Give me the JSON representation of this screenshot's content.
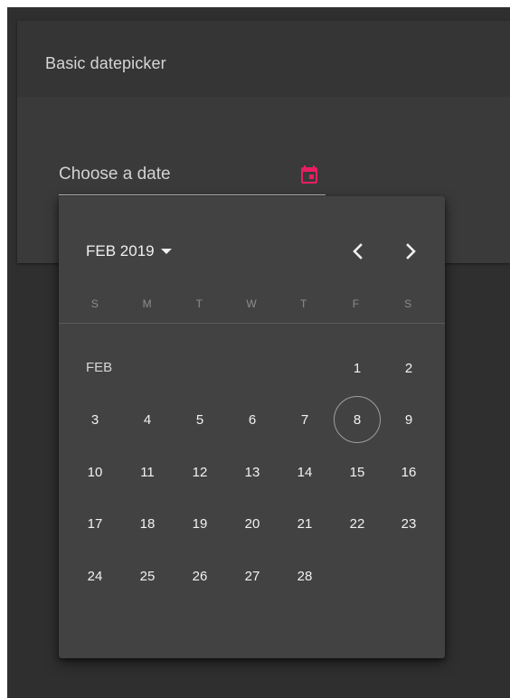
{
  "card": {
    "title": "Basic datepicker"
  },
  "input": {
    "placeholder": "Choose a date",
    "value": "",
    "icon": "calendar-icon"
  },
  "colors": {
    "accent": "#e91e63",
    "popup_bg": "#424242",
    "page_bg": "#2f2f2f"
  },
  "calendar": {
    "period_label": "FEB 2019",
    "month_label": "FEB",
    "weekdays": [
      "S",
      "M",
      "T",
      "W",
      "T",
      "F",
      "S"
    ],
    "first_weekday_index": 5,
    "today": 8,
    "weeks": [
      [
        "",
        "",
        "",
        "",
        "",
        "1",
        "2"
      ],
      [
        "3",
        "4",
        "5",
        "6",
        "7",
        "8",
        "9"
      ],
      [
        "10",
        "11",
        "12",
        "13",
        "14",
        "15",
        "16"
      ],
      [
        "17",
        "18",
        "19",
        "20",
        "21",
        "22",
        "23"
      ],
      [
        "24",
        "25",
        "26",
        "27",
        "28",
        "",
        ""
      ]
    ],
    "prev_icon": "chevron-left-icon",
    "next_icon": "chevron-right-icon",
    "period_icon": "caret-down-icon"
  }
}
